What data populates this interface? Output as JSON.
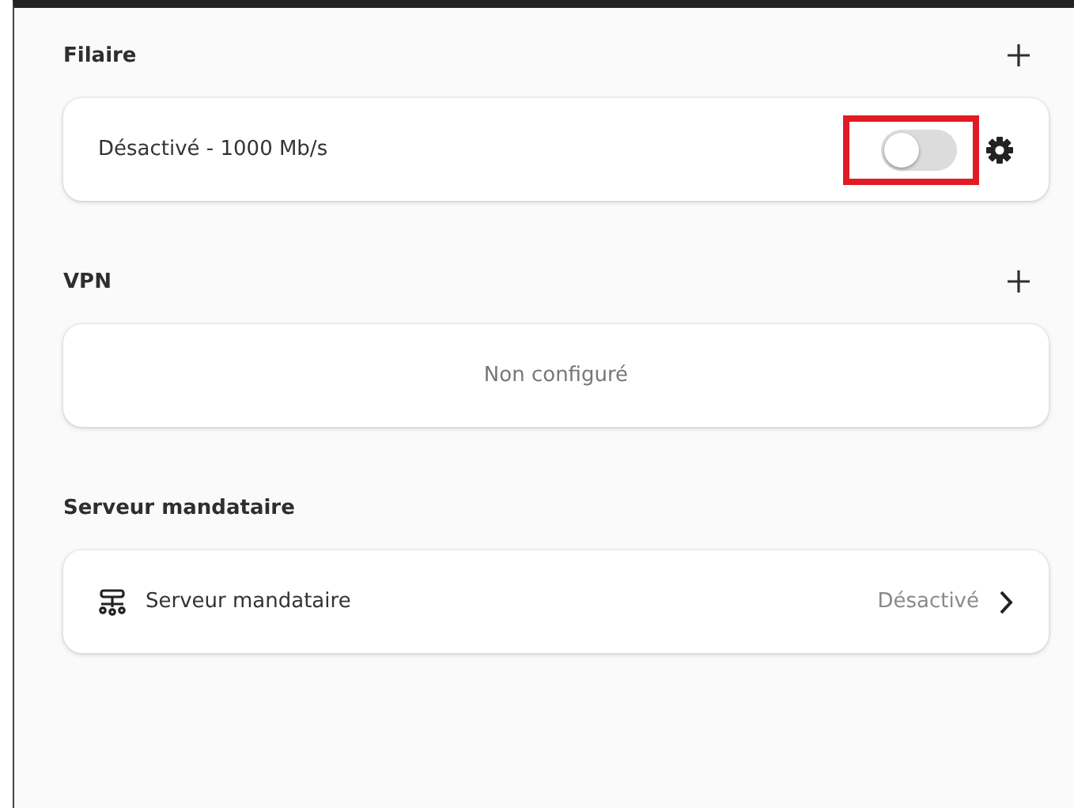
{
  "sections": [
    {
      "title": "Filaire",
      "has_add": true,
      "row": {
        "kind": "switch",
        "label": "Désactivé - 1000 Mb/s",
        "on": false,
        "highlighted": true
      }
    },
    {
      "title": "VPN",
      "has_add": true,
      "row": {
        "kind": "empty",
        "label": "Non configuré"
      }
    },
    {
      "title": "Serveur mandataire",
      "has_add": false,
      "row": {
        "kind": "link",
        "label": "Serveur mandataire",
        "value": "Désactivé"
      }
    }
  ]
}
